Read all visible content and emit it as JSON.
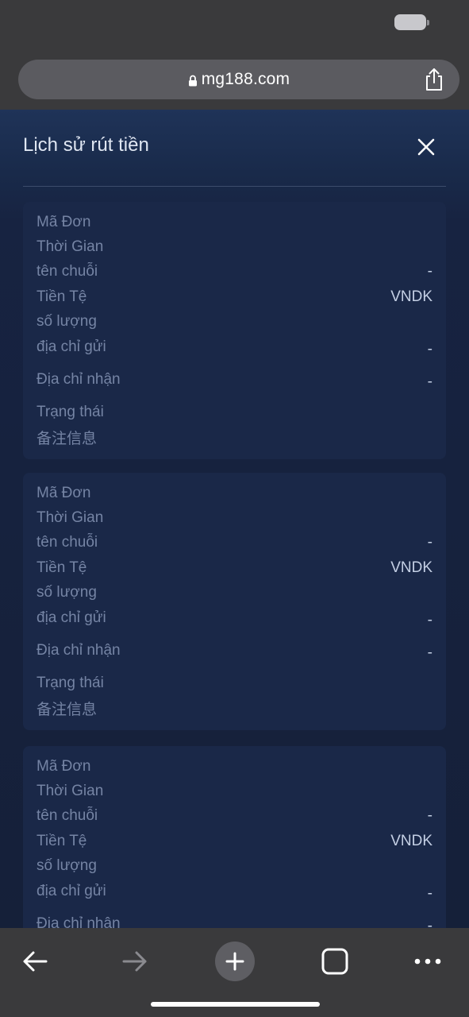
{
  "browser": {
    "url": "mg188.com",
    "icons": [
      "lock-icon",
      "share-icon",
      "back-icon",
      "forward-icon",
      "new-tab-icon",
      "tabs-icon",
      "more-icon"
    ]
  },
  "modal": {
    "title": "Lịch sử rút tiền"
  },
  "labels": {
    "order_id": "Mã Đơn",
    "time": "Thời Gian",
    "chain_name": "tên chuỗi",
    "currency": "Tiền Tệ",
    "amount": "số lượng",
    "from_address": "địa chỉ gửi",
    "to_address": "Địa chỉ nhận",
    "status": "Trạng thái",
    "remark": "备注信息"
  },
  "records": [
    {
      "order_id": "",
      "time": "",
      "chain_name": "-",
      "currency": "VNDK",
      "amount": "",
      "from_address": "-",
      "to_address": "-",
      "status": "",
      "remark": ""
    },
    {
      "order_id": "",
      "time": "",
      "chain_name": "-",
      "currency": "VNDK",
      "amount": "",
      "from_address": "-",
      "to_address": "-",
      "status": "",
      "remark": ""
    },
    {
      "order_id": "",
      "time": "",
      "chain_name": "-",
      "currency": "VNDK",
      "amount": "",
      "from_address": "-",
      "to_address": "-",
      "status": "",
      "remark": ""
    }
  ]
}
